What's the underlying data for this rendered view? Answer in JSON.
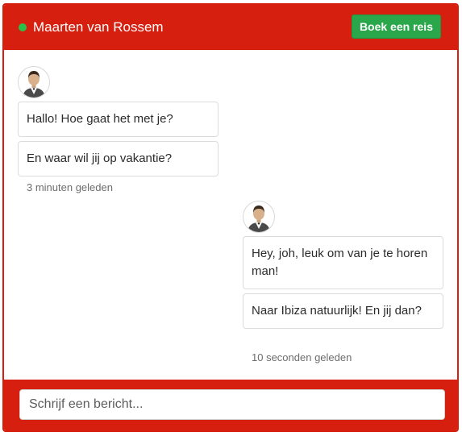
{
  "header": {
    "contact_name": "Maarten van Rossem",
    "status": "online",
    "book_button_label": "Boek een reis"
  },
  "messages": [
    {
      "side": "left",
      "avatar_icon": "male-avatar-icon",
      "bubbles": [
        "Hallo! Hoe gaat het met je?",
        "En waar wil jij op vakantie?"
      ],
      "time": "3 minuten geleden"
    },
    {
      "side": "right",
      "avatar_icon": "male-avatar-icon",
      "bubbles": [
        "Hey, joh, leuk om van je te horen man!",
        "Naar Ibiza natuurlijk! En jij dan?"
      ],
      "time": "10 seconden geleden"
    }
  ],
  "composer": {
    "placeholder": "Schrijf een bericht...",
    "value": ""
  },
  "colors": {
    "brand": "#d61f0f",
    "button_green": "#2aa74a",
    "online_dot": "#29c14a"
  }
}
